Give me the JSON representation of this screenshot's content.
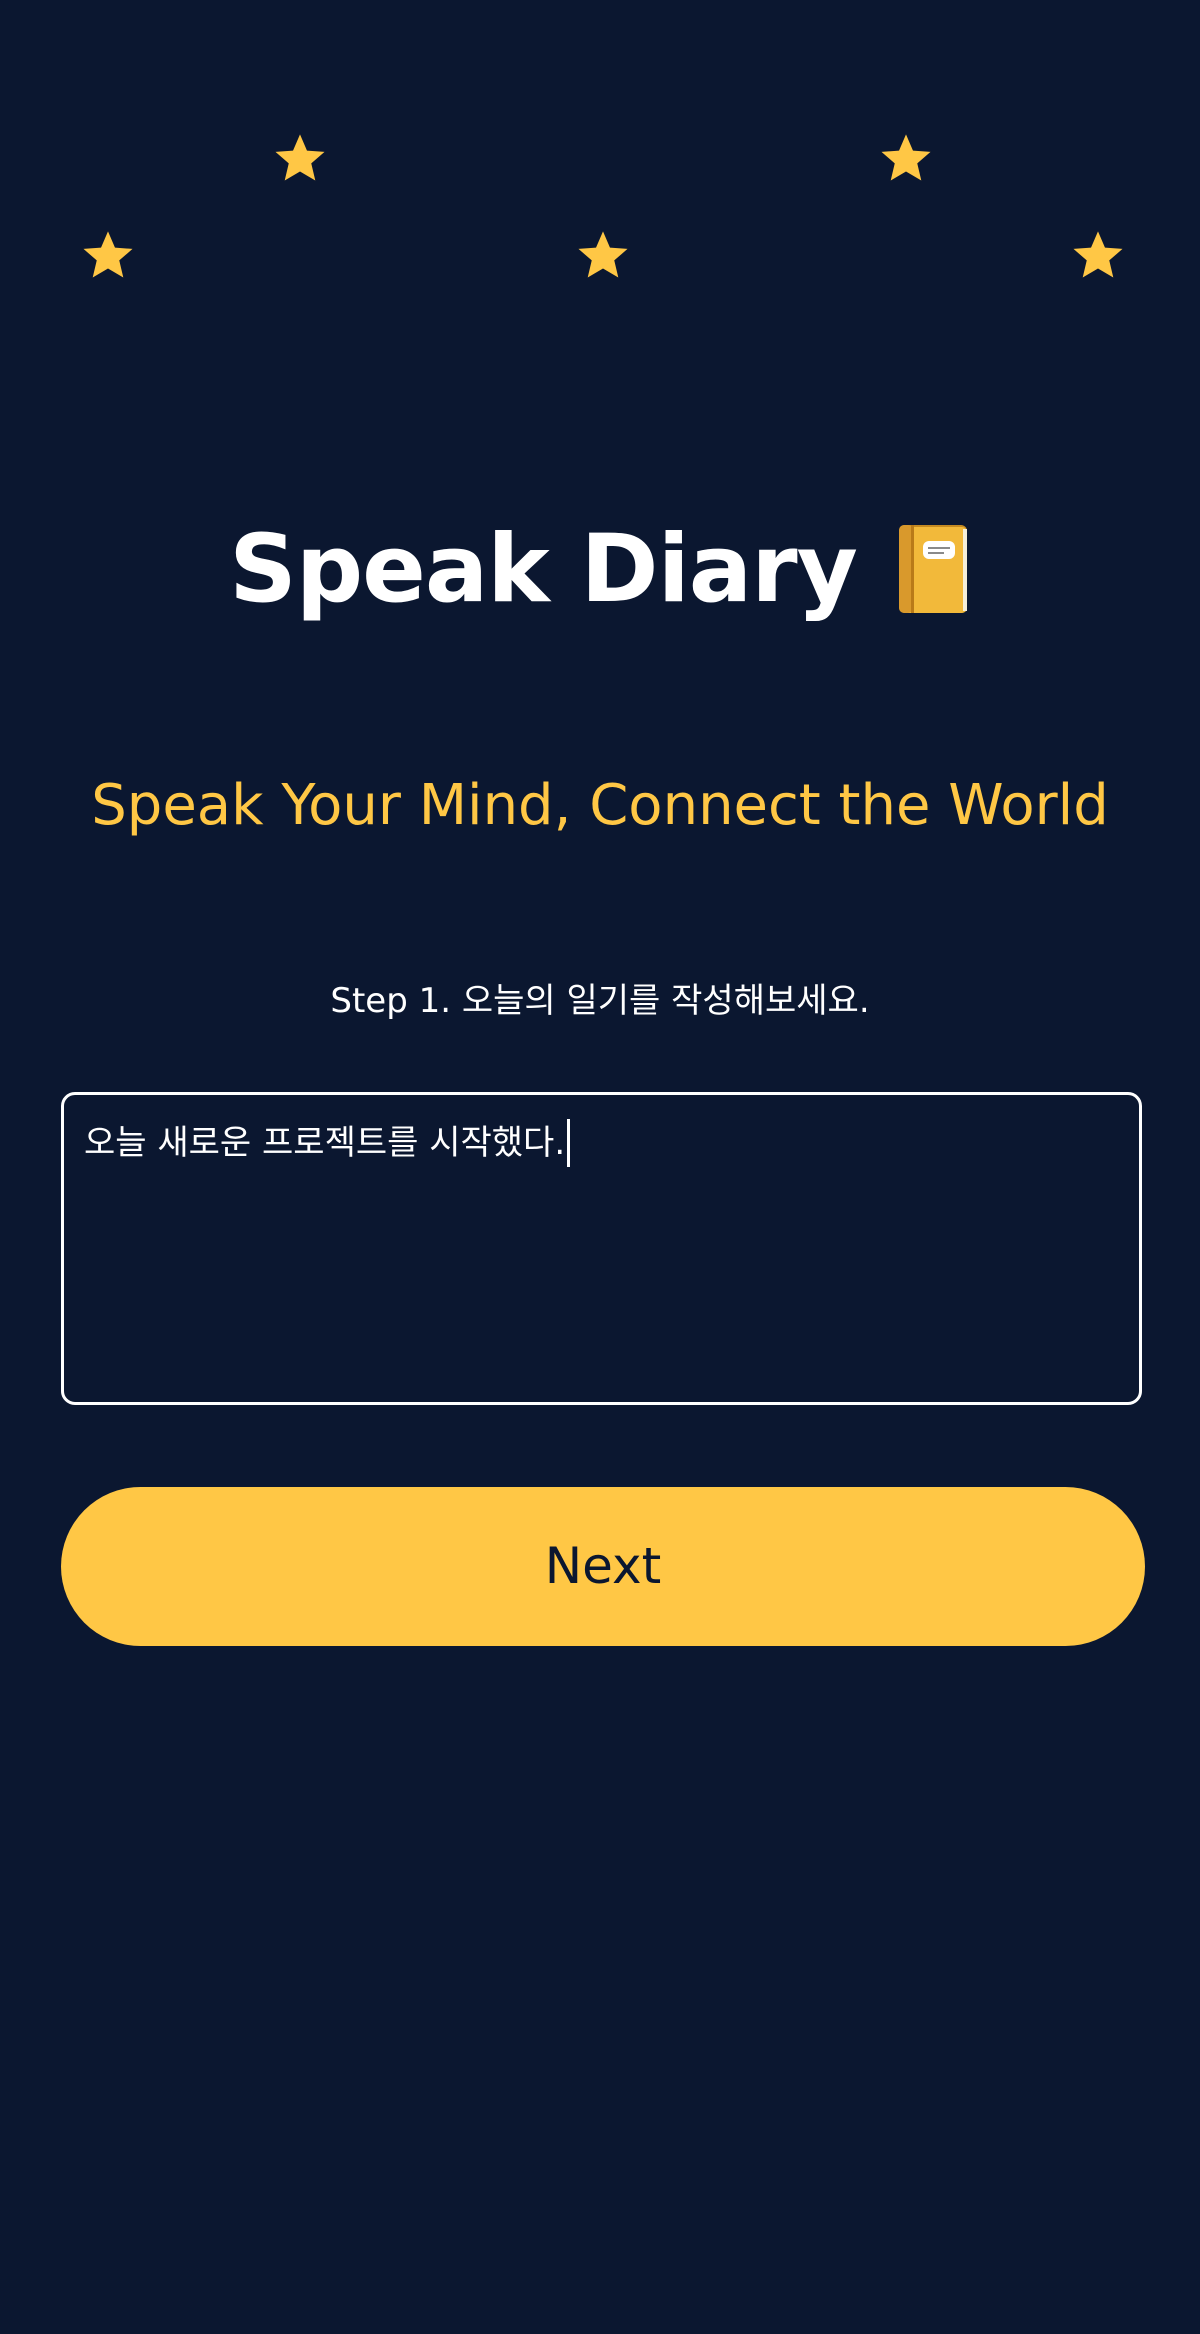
{
  "app": {
    "title": "Speak Diary",
    "title_icon": "notebook-icon",
    "tagline": "Speak Your Mind, Connect the World"
  },
  "decorations": {
    "star_icon": "star-icon",
    "star_color": "#ffc745"
  },
  "step": {
    "label": "Step 1.  오늘의 일기를 작성해보세요."
  },
  "diary": {
    "value": "오늘 새로운 프로젝트를 시작했다."
  },
  "actions": {
    "next_label": "Next"
  },
  "colors": {
    "background": "#0b1730",
    "accent": "#ffc745",
    "text": "#ffffff"
  }
}
